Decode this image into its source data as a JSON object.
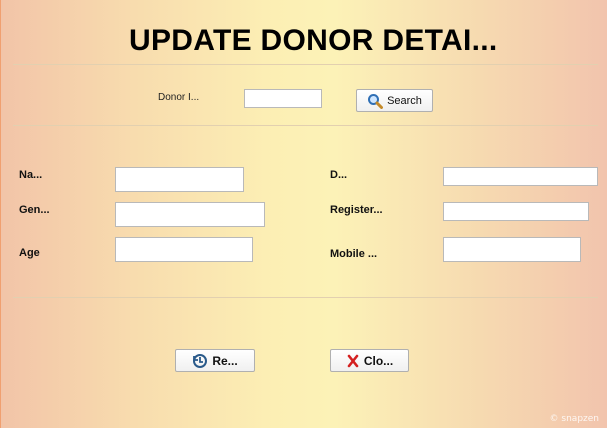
{
  "title": "UPDATE DONOR DETAI...",
  "search": {
    "label": "Donor I...",
    "value": "",
    "button_label": "Search"
  },
  "form": {
    "name_label": "Na...",
    "gender_label": "Gen...",
    "age_label": "Age",
    "d_label": "D...",
    "register_label": "Register...",
    "mobile_label": "Mobile ...",
    "name_value": "",
    "gender_value": "",
    "age_value": "",
    "d_value": "",
    "register_value": "",
    "mobile_value": ""
  },
  "actions": {
    "reset_label": "Re...",
    "close_label": "Clo..."
  },
  "watermark": "© snapzen",
  "icons": {
    "search": "magnifier-icon",
    "reset": "reset-icon",
    "close": "close-x-icon"
  },
  "colors": {
    "close_icon": "#d42020",
    "search_icon": "#2f6fb5",
    "reset_icon": "#2a5a8a"
  }
}
